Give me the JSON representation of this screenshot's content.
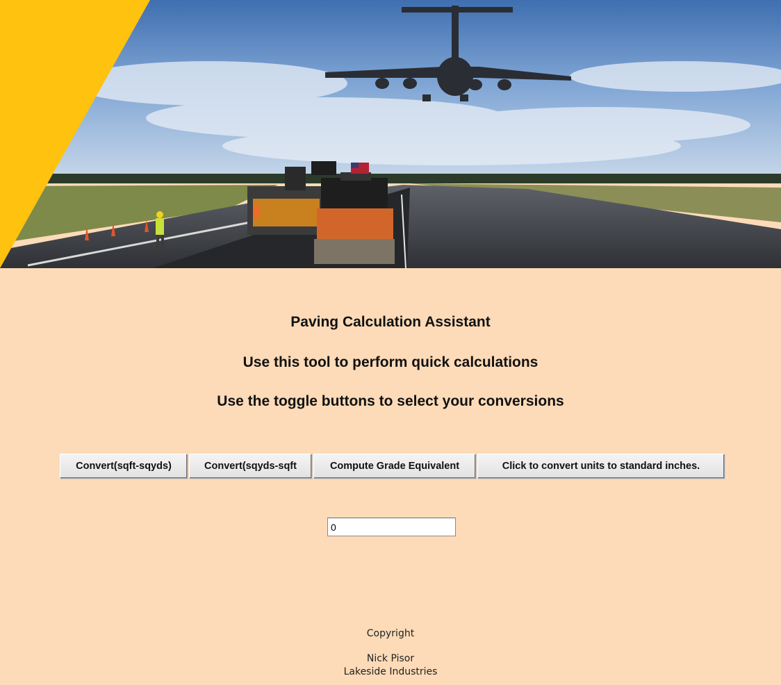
{
  "hero": {
    "scene": "airport-runway-paving-with-cargo-plane",
    "accent_color": "#FFC20E"
  },
  "headings": {
    "title": "Paving Calculation Assistant",
    "subtitle1": "Use this tool to perform quick calculations",
    "subtitle2": "Use the toggle buttons to select your conversions"
  },
  "toolbar": {
    "sqft_to_sqyds": "Convert(sqft-sqyds)",
    "sqyds_to_sqft": "Convert(sqyds-sqft",
    "grade_equivalent": "Compute Grade Equivalent",
    "standard_inches": "Click to convert units to standard inches."
  },
  "input": {
    "value": "0"
  },
  "footer": {
    "copyright": "Copyright",
    "author": "Nick Pisor",
    "company": "Lakeside Industries"
  },
  "colors": {
    "page_background": "#FDDBB8",
    "accent": "#FFC20E"
  }
}
